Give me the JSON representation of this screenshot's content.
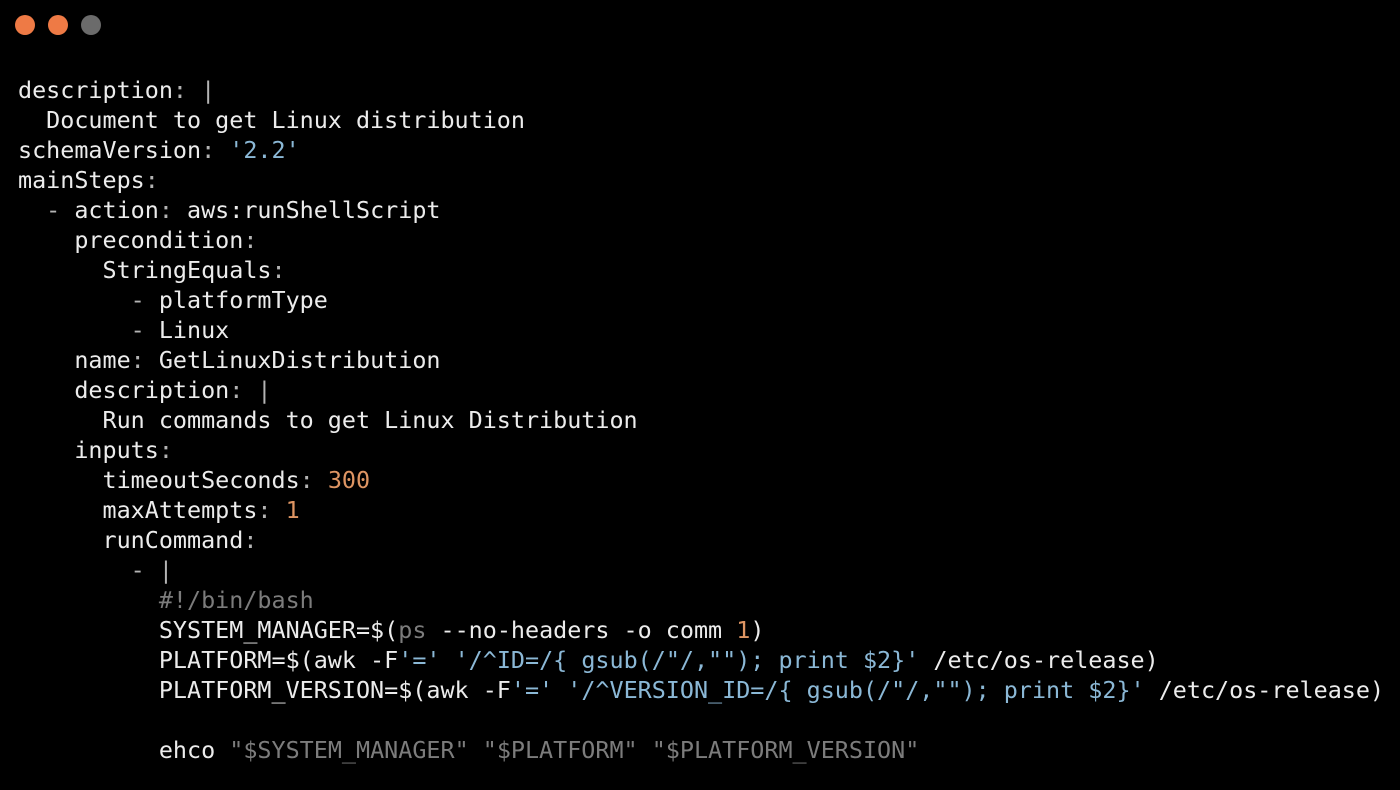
{
  "window": {
    "background": "#000000",
    "controls": [
      {
        "name": "close-button",
        "color": "#ee7a45"
      },
      {
        "name": "minimize-button",
        "color": "#ee7a45"
      },
      {
        "name": "maximize-button",
        "color": "#6b6b6b"
      }
    ]
  },
  "colors": {
    "text": "#ececec",
    "string": "#8bb8d6",
    "number": "#de9563",
    "comment": "#7c7c7c",
    "punctuation": "#b4b4b4"
  },
  "code": {
    "lines": [
      [
        {
          "t": "description",
          "c": "key"
        },
        {
          "t": ": |",
          "c": "punc"
        }
      ],
      [
        {
          "t": "  Document to get Linux distribution",
          "c": "key"
        }
      ],
      [
        {
          "t": "schemaVersion",
          "c": "key"
        },
        {
          "t": ": ",
          "c": "punc"
        },
        {
          "t": "'2.2'",
          "c": "str"
        }
      ],
      [
        {
          "t": "mainSteps",
          "c": "key"
        },
        {
          "t": ":",
          "c": "punc"
        }
      ],
      [
        {
          "t": "  - ",
          "c": "punc"
        },
        {
          "t": "action",
          "c": "key"
        },
        {
          "t": ": ",
          "c": "punc"
        },
        {
          "t": "aws:runShellScript",
          "c": "key"
        }
      ],
      [
        {
          "t": "    precondition",
          "c": "key"
        },
        {
          "t": ":",
          "c": "punc"
        }
      ],
      [
        {
          "t": "      StringEquals",
          "c": "key"
        },
        {
          "t": ":",
          "c": "punc"
        }
      ],
      [
        {
          "t": "        - ",
          "c": "punc"
        },
        {
          "t": "platformType",
          "c": "key"
        }
      ],
      [
        {
          "t": "        - ",
          "c": "punc"
        },
        {
          "t": "Linux",
          "c": "key"
        }
      ],
      [
        {
          "t": "    name",
          "c": "key"
        },
        {
          "t": ": ",
          "c": "punc"
        },
        {
          "t": "GetLinuxDistribution",
          "c": "key"
        }
      ],
      [
        {
          "t": "    description",
          "c": "key"
        },
        {
          "t": ": |",
          "c": "punc"
        }
      ],
      [
        {
          "t": "      Run commands to get Linux Distribution",
          "c": "key"
        }
      ],
      [
        {
          "t": "    inputs",
          "c": "key"
        },
        {
          "t": ":",
          "c": "punc"
        }
      ],
      [
        {
          "t": "      timeoutSeconds",
          "c": "key"
        },
        {
          "t": ": ",
          "c": "punc"
        },
        {
          "t": "300",
          "c": "num"
        }
      ],
      [
        {
          "t": "      maxAttempts",
          "c": "key"
        },
        {
          "t": ": ",
          "c": "punc"
        },
        {
          "t": "1",
          "c": "num"
        }
      ],
      [
        {
          "t": "      runCommand",
          "c": "key"
        },
        {
          "t": ":",
          "c": "punc"
        }
      ],
      [
        {
          "t": "        - |",
          "c": "punc"
        }
      ],
      [
        {
          "t": "          #!/bin/bash",
          "c": "cmt"
        }
      ],
      [
        {
          "t": "          SYSTEM_MANAGER=$(",
          "c": "key"
        },
        {
          "t": "ps",
          "c": "cmt"
        },
        {
          "t": " --no-headers -o comm ",
          "c": "key"
        },
        {
          "t": "1",
          "c": "num"
        },
        {
          "t": ")",
          "c": "key"
        }
      ],
      [
        {
          "t": "          PLATFORM=$(awk -F",
          "c": "key"
        },
        {
          "t": "'='",
          "c": "str"
        },
        {
          "t": " ",
          "c": "key"
        },
        {
          "t": "'/^ID=/{ gsub(/\"/,\"\"); print $2}'",
          "c": "str"
        },
        {
          "t": " /etc/os-release)",
          "c": "key"
        }
      ],
      [
        {
          "t": "          PLATFORM_VERSION=$(awk -F",
          "c": "key"
        },
        {
          "t": "'='",
          "c": "str"
        },
        {
          "t": " ",
          "c": "key"
        },
        {
          "t": "'/^VERSION_ID=/{ gsub(/\"/,\"\"); print $2}'",
          "c": "str"
        },
        {
          "t": " /etc/os-release)",
          "c": "key"
        }
      ],
      [],
      [
        {
          "t": "          ehco ",
          "c": "key"
        },
        {
          "t": "\"$SYSTEM_MANAGER\" \"$PLATFORM\" \"$PLATFORM_VERSION\"",
          "c": "cmt"
        }
      ]
    ]
  }
}
